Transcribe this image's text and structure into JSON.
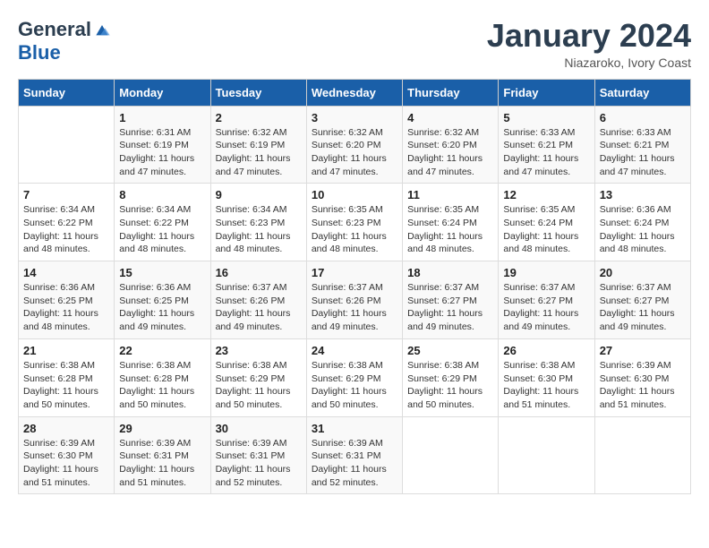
{
  "logo": {
    "general": "General",
    "blue": "Blue"
  },
  "title": "January 2024",
  "subtitle": "Niazaroko, Ivory Coast",
  "days_of_week": [
    "Sunday",
    "Monday",
    "Tuesday",
    "Wednesday",
    "Thursday",
    "Friday",
    "Saturday"
  ],
  "weeks": [
    [
      {
        "day": "",
        "info": ""
      },
      {
        "day": "1",
        "info": "Sunrise: 6:31 AM\nSunset: 6:19 PM\nDaylight: 11 hours and 47 minutes."
      },
      {
        "day": "2",
        "info": "Sunrise: 6:32 AM\nSunset: 6:19 PM\nDaylight: 11 hours and 47 minutes."
      },
      {
        "day": "3",
        "info": "Sunrise: 6:32 AM\nSunset: 6:20 PM\nDaylight: 11 hours and 47 minutes."
      },
      {
        "day": "4",
        "info": "Sunrise: 6:32 AM\nSunset: 6:20 PM\nDaylight: 11 hours and 47 minutes."
      },
      {
        "day": "5",
        "info": "Sunrise: 6:33 AM\nSunset: 6:21 PM\nDaylight: 11 hours and 47 minutes."
      },
      {
        "day": "6",
        "info": "Sunrise: 6:33 AM\nSunset: 6:21 PM\nDaylight: 11 hours and 47 minutes."
      }
    ],
    [
      {
        "day": "7",
        "info": "Sunrise: 6:34 AM\nSunset: 6:22 PM\nDaylight: 11 hours and 48 minutes."
      },
      {
        "day": "8",
        "info": "Sunrise: 6:34 AM\nSunset: 6:22 PM\nDaylight: 11 hours and 48 minutes."
      },
      {
        "day": "9",
        "info": "Sunrise: 6:34 AM\nSunset: 6:23 PM\nDaylight: 11 hours and 48 minutes."
      },
      {
        "day": "10",
        "info": "Sunrise: 6:35 AM\nSunset: 6:23 PM\nDaylight: 11 hours and 48 minutes."
      },
      {
        "day": "11",
        "info": "Sunrise: 6:35 AM\nSunset: 6:24 PM\nDaylight: 11 hours and 48 minutes."
      },
      {
        "day": "12",
        "info": "Sunrise: 6:35 AM\nSunset: 6:24 PM\nDaylight: 11 hours and 48 minutes."
      },
      {
        "day": "13",
        "info": "Sunrise: 6:36 AM\nSunset: 6:24 PM\nDaylight: 11 hours and 48 minutes."
      }
    ],
    [
      {
        "day": "14",
        "info": "Sunrise: 6:36 AM\nSunset: 6:25 PM\nDaylight: 11 hours and 48 minutes."
      },
      {
        "day": "15",
        "info": "Sunrise: 6:36 AM\nSunset: 6:25 PM\nDaylight: 11 hours and 49 minutes."
      },
      {
        "day": "16",
        "info": "Sunrise: 6:37 AM\nSunset: 6:26 PM\nDaylight: 11 hours and 49 minutes."
      },
      {
        "day": "17",
        "info": "Sunrise: 6:37 AM\nSunset: 6:26 PM\nDaylight: 11 hours and 49 minutes."
      },
      {
        "day": "18",
        "info": "Sunrise: 6:37 AM\nSunset: 6:27 PM\nDaylight: 11 hours and 49 minutes."
      },
      {
        "day": "19",
        "info": "Sunrise: 6:37 AM\nSunset: 6:27 PM\nDaylight: 11 hours and 49 minutes."
      },
      {
        "day": "20",
        "info": "Sunrise: 6:37 AM\nSunset: 6:27 PM\nDaylight: 11 hours and 49 minutes."
      }
    ],
    [
      {
        "day": "21",
        "info": "Sunrise: 6:38 AM\nSunset: 6:28 PM\nDaylight: 11 hours and 50 minutes."
      },
      {
        "day": "22",
        "info": "Sunrise: 6:38 AM\nSunset: 6:28 PM\nDaylight: 11 hours and 50 minutes."
      },
      {
        "day": "23",
        "info": "Sunrise: 6:38 AM\nSunset: 6:29 PM\nDaylight: 11 hours and 50 minutes."
      },
      {
        "day": "24",
        "info": "Sunrise: 6:38 AM\nSunset: 6:29 PM\nDaylight: 11 hours and 50 minutes."
      },
      {
        "day": "25",
        "info": "Sunrise: 6:38 AM\nSunset: 6:29 PM\nDaylight: 11 hours and 50 minutes."
      },
      {
        "day": "26",
        "info": "Sunrise: 6:38 AM\nSunset: 6:30 PM\nDaylight: 11 hours and 51 minutes."
      },
      {
        "day": "27",
        "info": "Sunrise: 6:39 AM\nSunset: 6:30 PM\nDaylight: 11 hours and 51 minutes."
      }
    ],
    [
      {
        "day": "28",
        "info": "Sunrise: 6:39 AM\nSunset: 6:30 PM\nDaylight: 11 hours and 51 minutes."
      },
      {
        "day": "29",
        "info": "Sunrise: 6:39 AM\nSunset: 6:31 PM\nDaylight: 11 hours and 51 minutes."
      },
      {
        "day": "30",
        "info": "Sunrise: 6:39 AM\nSunset: 6:31 PM\nDaylight: 11 hours and 52 minutes."
      },
      {
        "day": "31",
        "info": "Sunrise: 6:39 AM\nSunset: 6:31 PM\nDaylight: 11 hours and 52 minutes."
      },
      {
        "day": "",
        "info": ""
      },
      {
        "day": "",
        "info": ""
      },
      {
        "day": "",
        "info": ""
      }
    ]
  ]
}
